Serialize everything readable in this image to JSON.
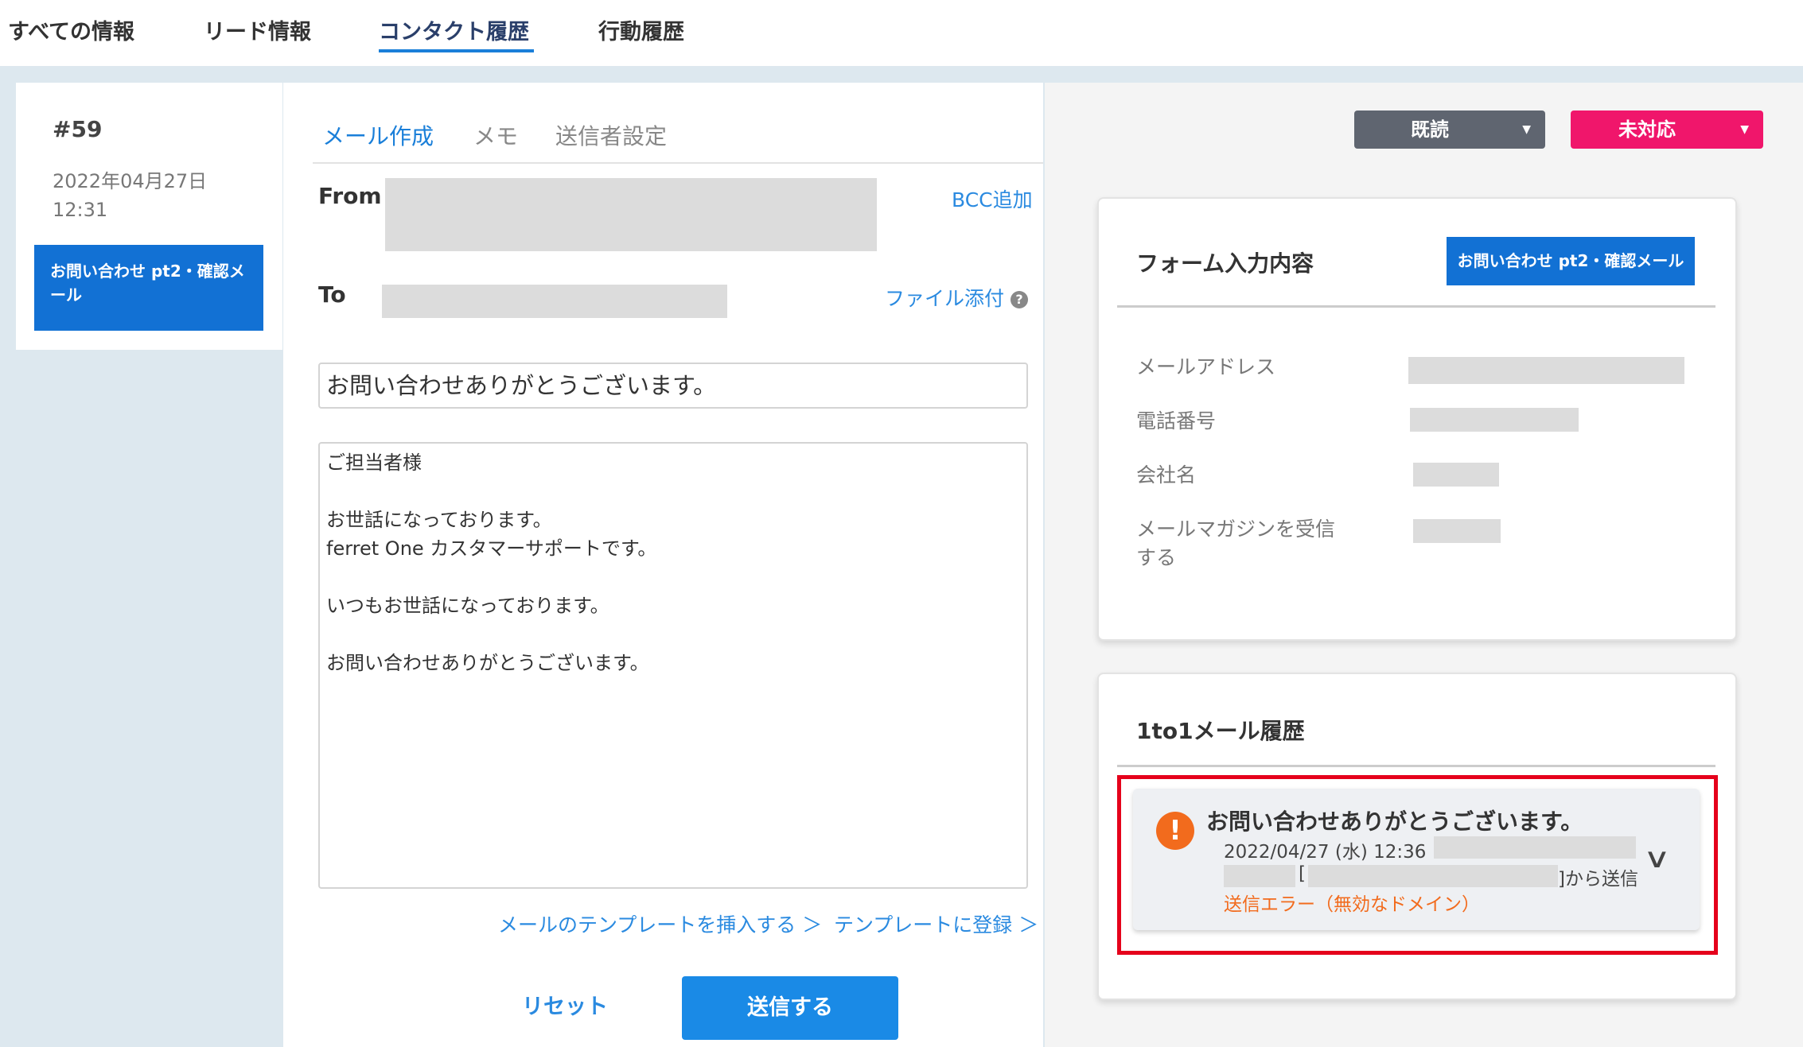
{
  "top_tabs": [
    "すべての情報",
    "リード情報",
    "コンタクト履歴",
    "行動履歴"
  ],
  "left": {
    "number": "#59",
    "date": "2022年04月27日",
    "time": "12:31",
    "item_label": "お問い合わせ pt2・確認メール"
  },
  "mail": {
    "subtabs": [
      "メール作成",
      "メモ",
      "送信者設定"
    ],
    "from_label": "From",
    "to_label": "To",
    "bcc_link": "BCC追加",
    "attach_link": "ファイル添付",
    "help_icon": "?",
    "subject": "お問い合わせありがとうございます。",
    "body_lines": [
      "ご担当者様",
      "",
      "お世話になっております。",
      "ferret One カスタマーサポートです。",
      "",
      "いつもお世話になっております。",
      "",
      "お問い合わせありがとうございます。"
    ],
    "insert_template_link": "メールのテンプレートを挿入する ＞",
    "register_template_link": "テンプレートに登録 ＞",
    "reset_label": "リセット",
    "send_label": "送信する"
  },
  "status": {
    "read_label": "既読",
    "read_caret": "▼",
    "read_color": "#5f6570",
    "response_label": "未対応",
    "response_caret": "▼",
    "response_color": "#f0166b"
  },
  "form_card": {
    "title": "フォーム入力内容",
    "badge": "お問い合わせ pt2・確認メール",
    "rows": [
      "メールアドレス",
      "電話番号",
      "会社名",
      "メールマガジンを受信する"
    ]
  },
  "history_card": {
    "title": "1to1メール履歴",
    "item": {
      "warning_icon": "!",
      "subject": "お問い合わせありがとうございます。",
      "datetime": "2022/04/27 (水) 12:36",
      "bracket_open": "[",
      "sent_suffix": "]から送信",
      "error": "送信エラー（無効なドメイン）",
      "error_color": "#f26b1d",
      "chevron": "∨"
    }
  },
  "colors": {
    "accent": "#1a7fd9",
    "highlight_border": "#e5001b"
  }
}
